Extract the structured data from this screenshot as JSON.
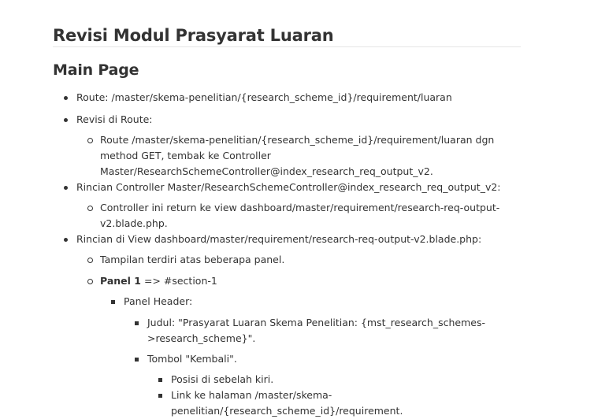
{
  "title": "Revisi Modul Prasyarat Luaran",
  "section": "Main Page",
  "items": {
    "route": "Route: /master/skema-penelitian/{research_scheme_id}/requirement/luaran",
    "revisi_route": "Revisi di Route:",
    "revisi_route_detail": [
      "Route /master/skema-penelitian/{research_scheme_id}/requirement/luaran dgn",
      "method GET, tembak ke Controller",
      "Master/ResearchSchemeController@index_research_req_output_v2."
    ],
    "rincian_controller": "Rincian Controller Master/ResearchSchemeController@index_research_req_output_v2:",
    "rincian_controller_detail": [
      "Controller ini return ke view dashboard/master/requirement/research-req-output-",
      "v2.blade.php."
    ],
    "rincian_view": "Rincian di View dashboard/master/requirement/research-req-output-v2.blade.php:",
    "tampilan": "Tampilan terdiri atas beberapa panel.",
    "panel1_strong": "Panel 1",
    "panel1_rest": " => #section-1",
    "panel_header": "Panel Header:",
    "judul": [
      "Judul: \"Prasyarat Luaran Skema Penelitian: {mst_research_schemes-",
      ">research_scheme}\"."
    ],
    "tombol": "Tombol \"Kembali\".",
    "posisi": "Posisi di sebelah kiri.",
    "link": [
      "Link ke halaman /master/skema-",
      "penelitian/{research_scheme_id}/requirement."
    ]
  }
}
